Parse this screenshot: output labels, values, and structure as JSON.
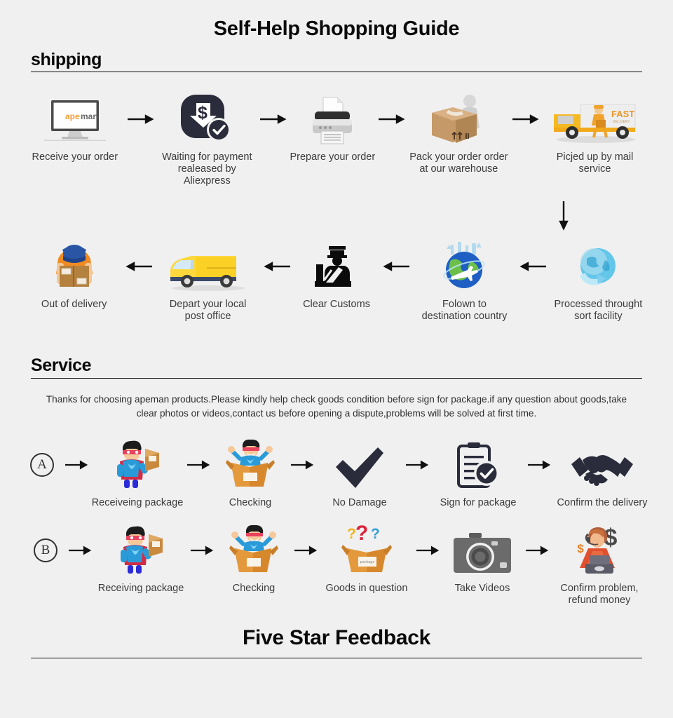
{
  "page": {
    "title": "Self-Help Shopping Guide",
    "footer_title": "Five Star Feedback",
    "background_color": "#f0f0f0",
    "brand_orange": "#f2a03d",
    "brand_dark": "#555555"
  },
  "shipping": {
    "heading": "shipping",
    "row1": [
      {
        "label": "Receive your order",
        "icon": "monitor-apeman-logo-icon"
      },
      {
        "label": "Waiting for payment\nrealeased by Aliexpress",
        "icon": "payment-dollar-check-icon"
      },
      {
        "label": "Prepare your order",
        "icon": "printer-icon"
      },
      {
        "label": "Pack your order order\nat our warehouse",
        "icon": "packing-box-worker-icon"
      },
      {
        "label": "Picjed up by mail service",
        "icon": "fast-delivery-truck-icon"
      }
    ],
    "row2": [
      {
        "label": "Out of delivery",
        "icon": "courier-holding-box-icon"
      },
      {
        "label": "Depart your local\npost office",
        "icon": "yellow-delivery-van-icon"
      },
      {
        "label": "Clear Customs",
        "icon": "customs-officer-icon"
      },
      {
        "label": "Folown to\ndestination country",
        "icon": "globe-airplane-icon"
      },
      {
        "label": "Processed throught\nsort facility",
        "icon": "blue-globe-arrow-icon"
      }
    ],
    "truck_text": {
      "primary": "FAST",
      "secondary": "DELIVERY"
    },
    "logo": {
      "part1": "ape",
      "part2": "man"
    }
  },
  "service": {
    "heading": "Service",
    "intro": "Thanks for choosing apeman products.Please kindly help check goods condition before sign for package.if any question about goods,take clear photos or videos,contact us before opening a dispute,problems will be solved at first time.",
    "rowA": {
      "marker": "A",
      "steps": [
        {
          "label": "Receiveing package",
          "icon": "hero-with-package-icon"
        },
        {
          "label": "Checking",
          "icon": "hero-in-open-box-icon"
        },
        {
          "label": "No Damage",
          "icon": "checkmark-icon"
        },
        {
          "label": "Sign for package",
          "icon": "clipboard-check-icon"
        },
        {
          "label": "Confirm the delivery",
          "icon": "handshake-icon"
        }
      ]
    },
    "rowB": {
      "marker": "B",
      "steps": [
        {
          "label": "Receiving package",
          "icon": "hero-with-package-icon"
        },
        {
          "label": "Checking",
          "icon": "hero-in-open-box-icon"
        },
        {
          "label": "Goods in question",
          "icon": "questioned-box-icon"
        },
        {
          "label": "Take Videos",
          "icon": "camera-icon"
        },
        {
          "label": "Confirm problem,\nrefund money",
          "icon": "support-agent-refund-icon"
        }
      ]
    },
    "box_label": "package"
  }
}
